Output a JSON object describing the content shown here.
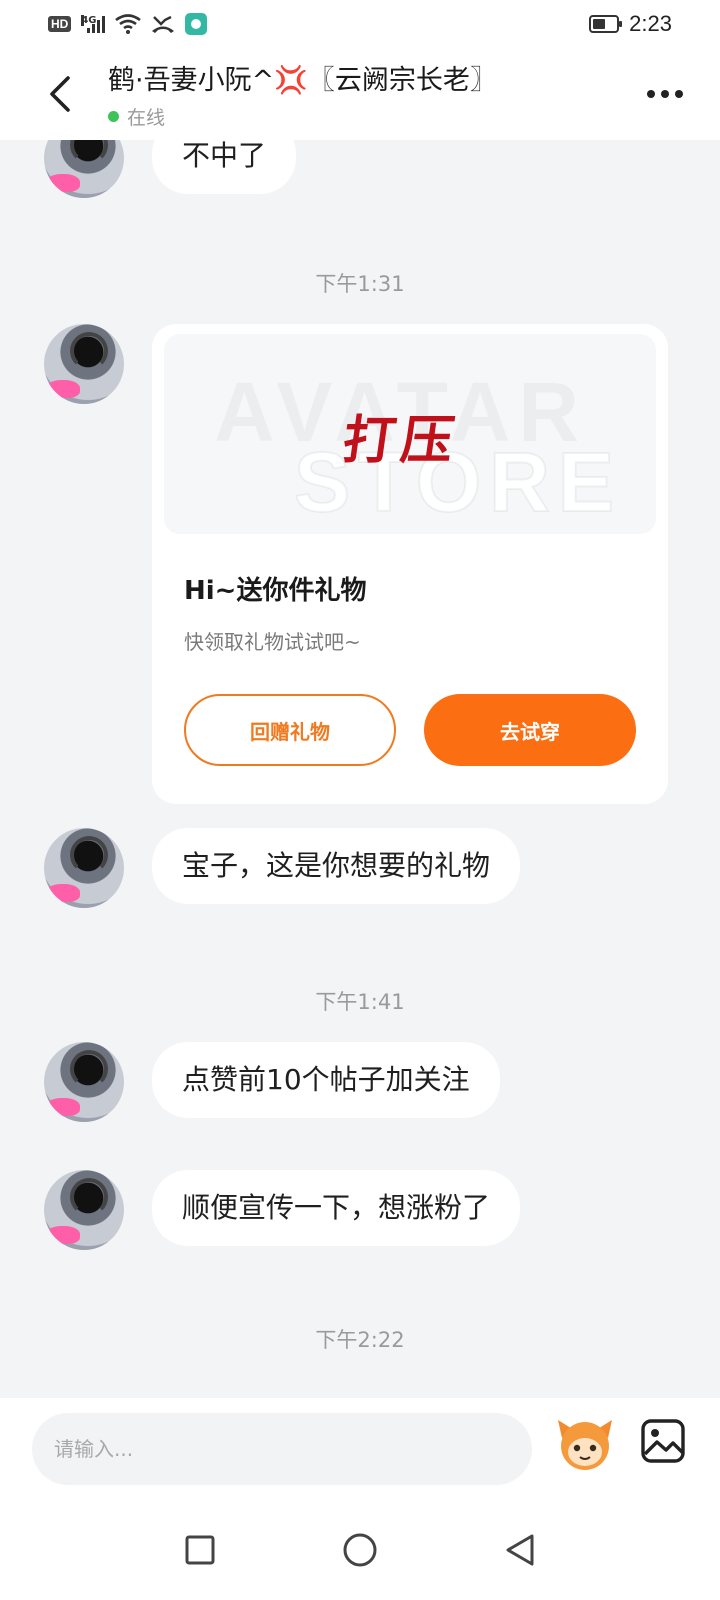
{
  "status_bar": {
    "hd_label": "HD",
    "network": "4G",
    "time": "2:23",
    "battery_level": 0.55,
    "icons": [
      "signal-icon",
      "wifi-icon",
      "missed-call-icon",
      "app-notification-icon",
      "battery-icon"
    ]
  },
  "header": {
    "contact_name": "鹤·吾妻小阮^💢〖云阙宗长老〗",
    "online_status": "在线",
    "online_color": "#3cc35a"
  },
  "chat": {
    "partial_message": "不中了",
    "timestamps": [
      "下午1:31",
      "下午1:41",
      "下午2:22"
    ],
    "gift_card": {
      "item_text": "打压",
      "watermark_line1": "AVATAR",
      "watermark_line2": "STORE",
      "title": "Hi~送你件礼物",
      "subtitle": "快领取礼物试试吧~",
      "return_gift_label": "回赠礼物",
      "try_on_label": "去试穿"
    },
    "messages": [
      "宝子，这是你想要的礼物",
      "点赞前10个帖子加关注",
      "顺便宣传一下，想涨粉了"
    ]
  },
  "input_bar": {
    "placeholder": "请输入..."
  },
  "colors": {
    "accent": "#fb6e12",
    "background": "#f3f4f6",
    "gift_text": "#c0101a"
  }
}
